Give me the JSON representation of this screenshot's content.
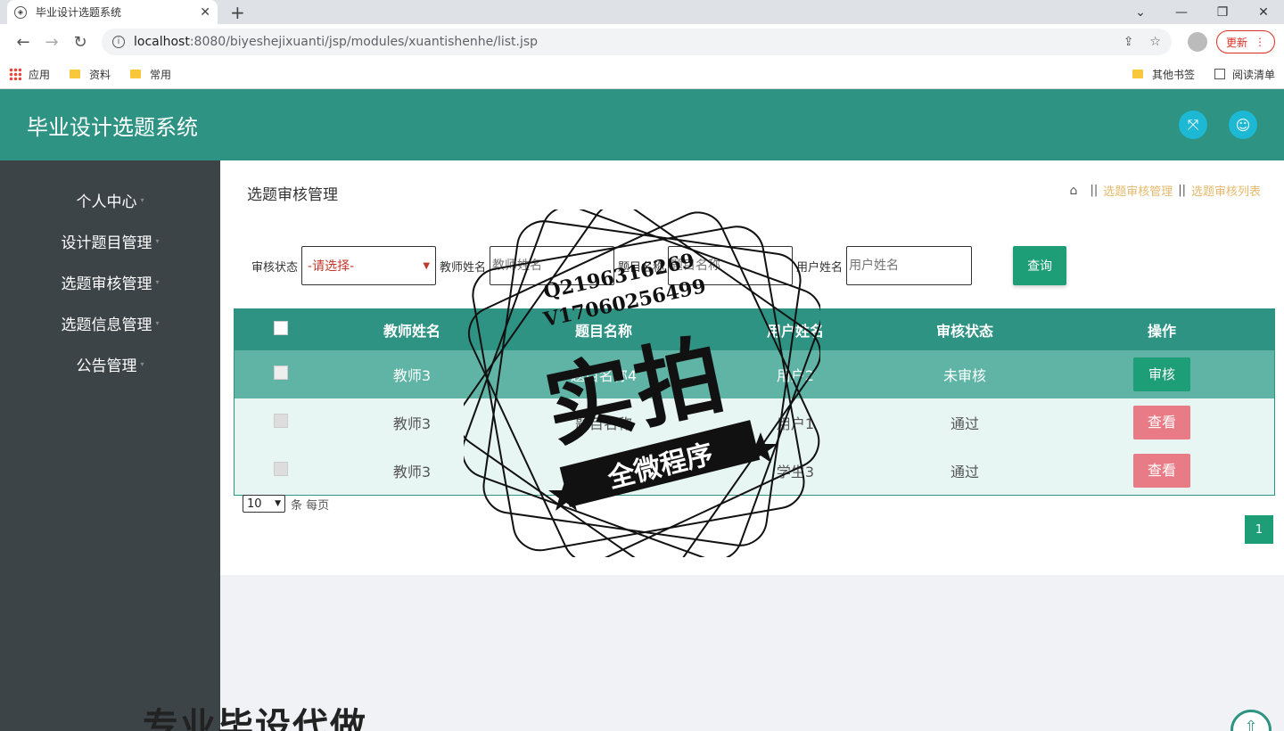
{
  "browser": {
    "tab_title": "毕业设计选题系统",
    "url_host": "localhost",
    "url_path": ":8080/biyeshejixuanti/jsp/modules/xuantishenhe/list.jsp",
    "update_label": "更新",
    "bookmarks": [
      "应用",
      "资料",
      "常用"
    ],
    "bookmarks_right": [
      "其他书签",
      "阅读清单"
    ]
  },
  "header": {
    "title": "毕业设计选题系统"
  },
  "sidebar": {
    "items": [
      {
        "label": "个人中心"
      },
      {
        "label": "设计题目管理"
      },
      {
        "label": "选题审核管理"
      },
      {
        "label": "选题信息管理"
      },
      {
        "label": "公告管理"
      }
    ]
  },
  "page": {
    "title": "选题审核管理",
    "breadcrumb": [
      "选题审核管理",
      "选题审核列表"
    ]
  },
  "search": {
    "status_label": "审核状态",
    "status_value": "-请选择-",
    "teacher_label": "教师姓名",
    "teacher_placeholder": "教师姓名",
    "topic_label": "题目名称",
    "topic_placeholder": "题目名称",
    "user_label": "用户姓名",
    "user_placeholder": "用户姓名",
    "query_label": "查询"
  },
  "table": {
    "headers": [
      "教师姓名",
      "题目名称",
      "用户姓名",
      "审核状态",
      "操作"
    ],
    "rows": [
      {
        "teacher": "教师3",
        "topic": "题目名称4",
        "user": "用户2",
        "status": "未审核",
        "action": "审核"
      },
      {
        "teacher": "教师3",
        "topic": "题目名称",
        "user": "用户1",
        "status": "通过",
        "action": "查看"
      },
      {
        "teacher": "教师3",
        "topic": "题",
        "user": "学生3",
        "status": "通过",
        "action": "查看"
      }
    ]
  },
  "pager": {
    "page_size": "10",
    "per_page_label": "条 每页",
    "current_page": "1"
  },
  "watermark": {
    "line1": "Q2196316269",
    "line2": "V17060256499",
    "big": "实拍",
    "ribbon": "全微程序"
  },
  "banner": {
    "text": "专业毕设代做"
  }
}
